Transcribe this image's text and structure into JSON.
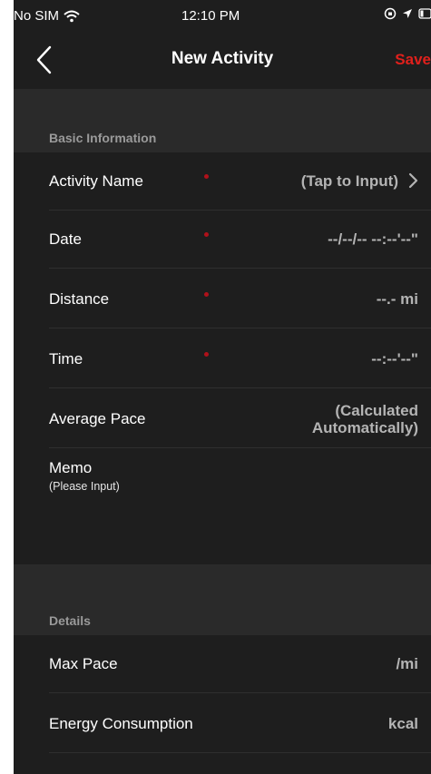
{
  "status_bar": {
    "carrier": "No SIM",
    "time": "12:10 PM",
    "icons": [
      "wifi-icon",
      "orientation-lock-icon",
      "location-arrow-icon",
      "battery-icon"
    ]
  },
  "nav": {
    "title": "New Activity",
    "save_label": "Save",
    "back_icon": "chevron-left-icon"
  },
  "colors": {
    "accent": "#e0201c",
    "background": "#1e1e1e",
    "section_background": "#2a2a2a",
    "required_dot": "#b0111a"
  },
  "basic_info": {
    "header": "Basic Information",
    "activity_name": {
      "label": "Activity Name",
      "value": "(Tap to Input)",
      "required": true
    },
    "date": {
      "label": "Date",
      "value": "--/--/-- --:--'--\"",
      "required": true
    },
    "distance": {
      "label": "Distance",
      "value": "--.- mi",
      "required": true
    },
    "time": {
      "label": "Time",
      "value": "--:--'--\"",
      "required": true
    },
    "average_pace": {
      "label": "Average Pace",
      "value_line1": "(Calculated",
      "value_line2": "Automatically)"
    },
    "memo": {
      "label": "Memo",
      "hint": "(Please Input)"
    }
  },
  "details": {
    "header": "Details",
    "max_pace": {
      "label": "Max Pace",
      "value": "/mi"
    },
    "energy": {
      "label": "Energy Consumption",
      "value": "kcal"
    }
  }
}
